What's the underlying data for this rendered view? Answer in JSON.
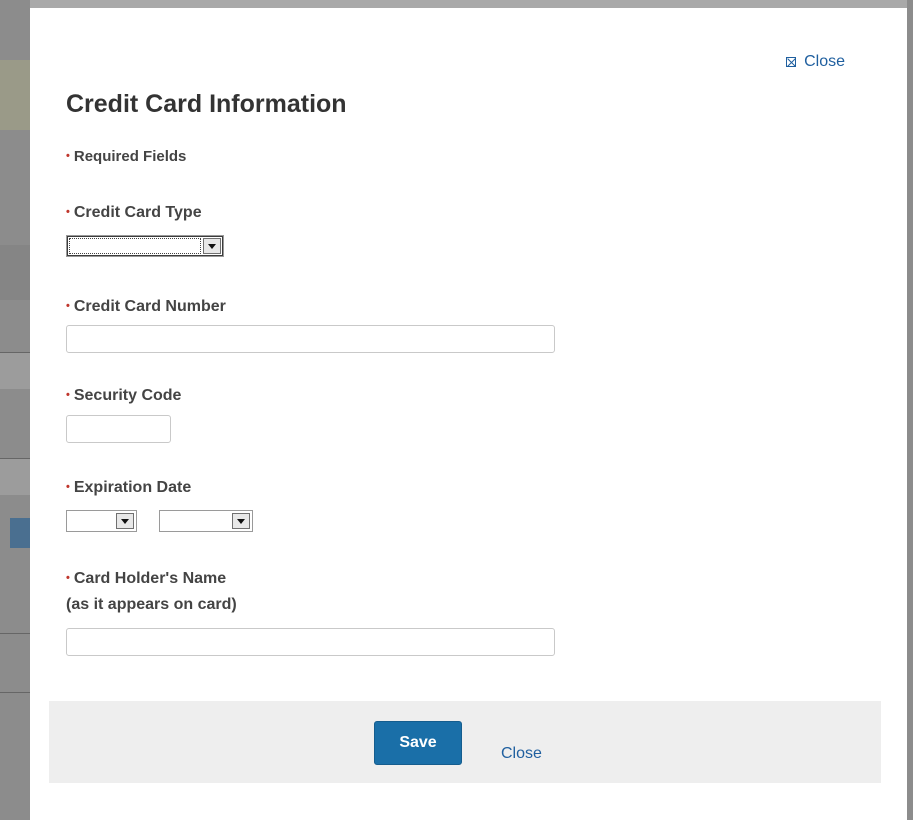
{
  "modal": {
    "close_top_label": "Close",
    "title": "Credit Card Information",
    "required_marker": "•",
    "required_note": "Required Fields",
    "fields": {
      "card_type_label": "Credit Card Type",
      "card_number_label": "Credit Card Number",
      "security_code_label": "Security Code",
      "expiration_label": "Expiration Date",
      "holder_name_label": "Card Holder's Name",
      "holder_name_hint": "(as it appears on card)"
    },
    "values": {
      "card_type": "",
      "card_number": "",
      "security_code": "",
      "exp_month": "",
      "exp_year": "",
      "holder_name": ""
    },
    "footer": {
      "save_label": "Save",
      "close_label": "Close"
    }
  },
  "colors": {
    "accent": "#1a6fa8",
    "link": "#1f5f9f",
    "required": "#c0362c",
    "overlay": "#7f7f7f"
  }
}
